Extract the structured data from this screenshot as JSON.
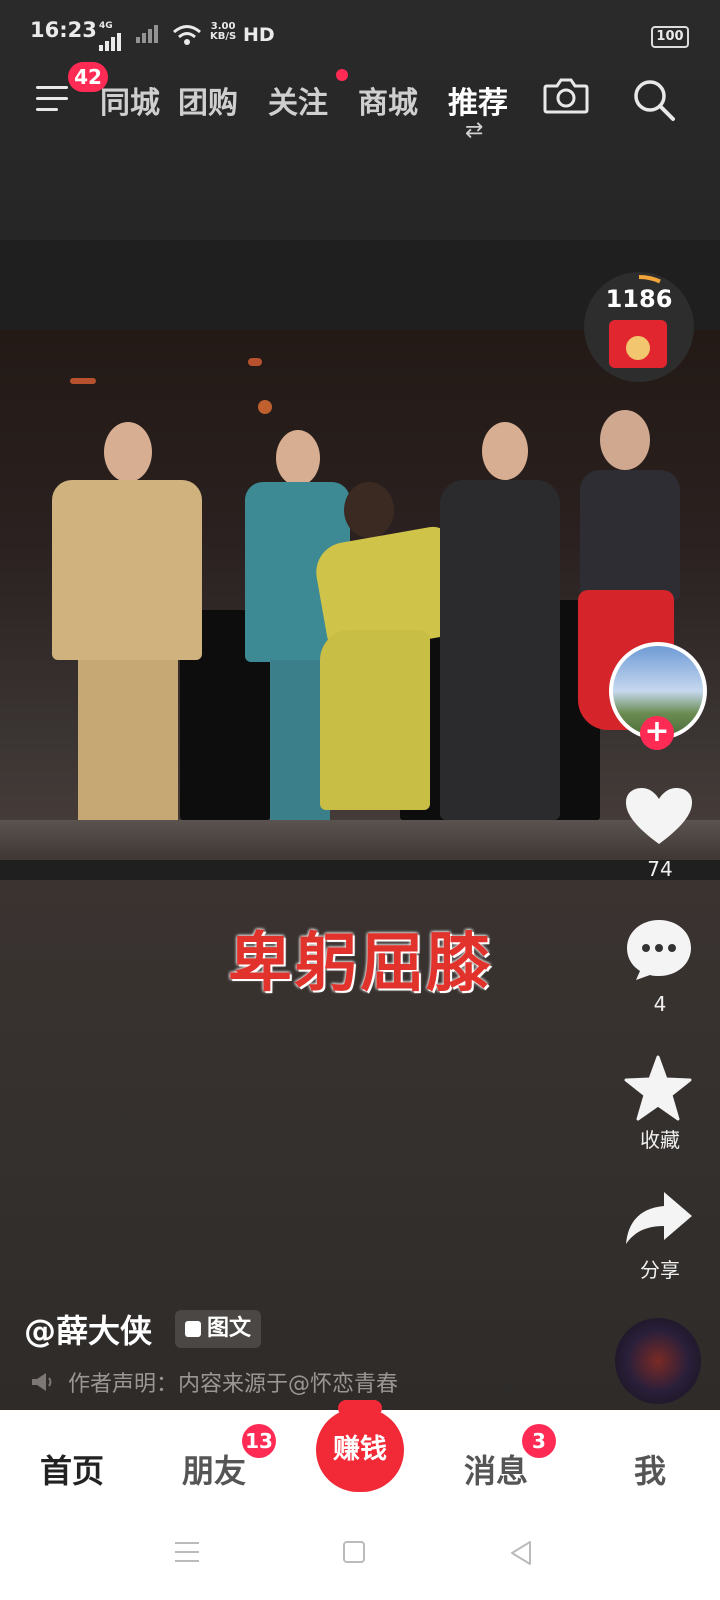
{
  "status_bar": {
    "time": "16:23",
    "network": "4G",
    "speed_value": "3.00",
    "speed_unit": "KB/S",
    "hd_label": "HD",
    "battery": "100"
  },
  "top_nav": {
    "menu_badge": "42",
    "tabs": [
      {
        "label": "同城"
      },
      {
        "label": "团购"
      },
      {
        "label": "关注"
      },
      {
        "label": "商城"
      },
      {
        "label": "推荐"
      }
    ],
    "active_tab": "推荐",
    "swap_icon": "⇄"
  },
  "right_rail": {
    "redpacket_count": "1186",
    "follow_plus": "+",
    "like_count": "74",
    "comment_count": "4",
    "collect_label": "收藏",
    "share_label": "分享"
  },
  "video": {
    "caption": "卑躬屈膝"
  },
  "author": {
    "name": "@薛大侠",
    "tag": "图文",
    "declaration": "作者声明：内容来源于@怀恋青春"
  },
  "bottom_nav": {
    "items": [
      {
        "label": "首页"
      },
      {
        "label": "朋友",
        "badge": "13"
      },
      {
        "label": "赚钱"
      },
      {
        "label": "消息",
        "badge": "3"
      },
      {
        "label": "我"
      }
    ]
  },
  "colors": {
    "accent": "#ff2b55",
    "caption_red": "#e2322c",
    "earn_red": "#f22a38"
  }
}
